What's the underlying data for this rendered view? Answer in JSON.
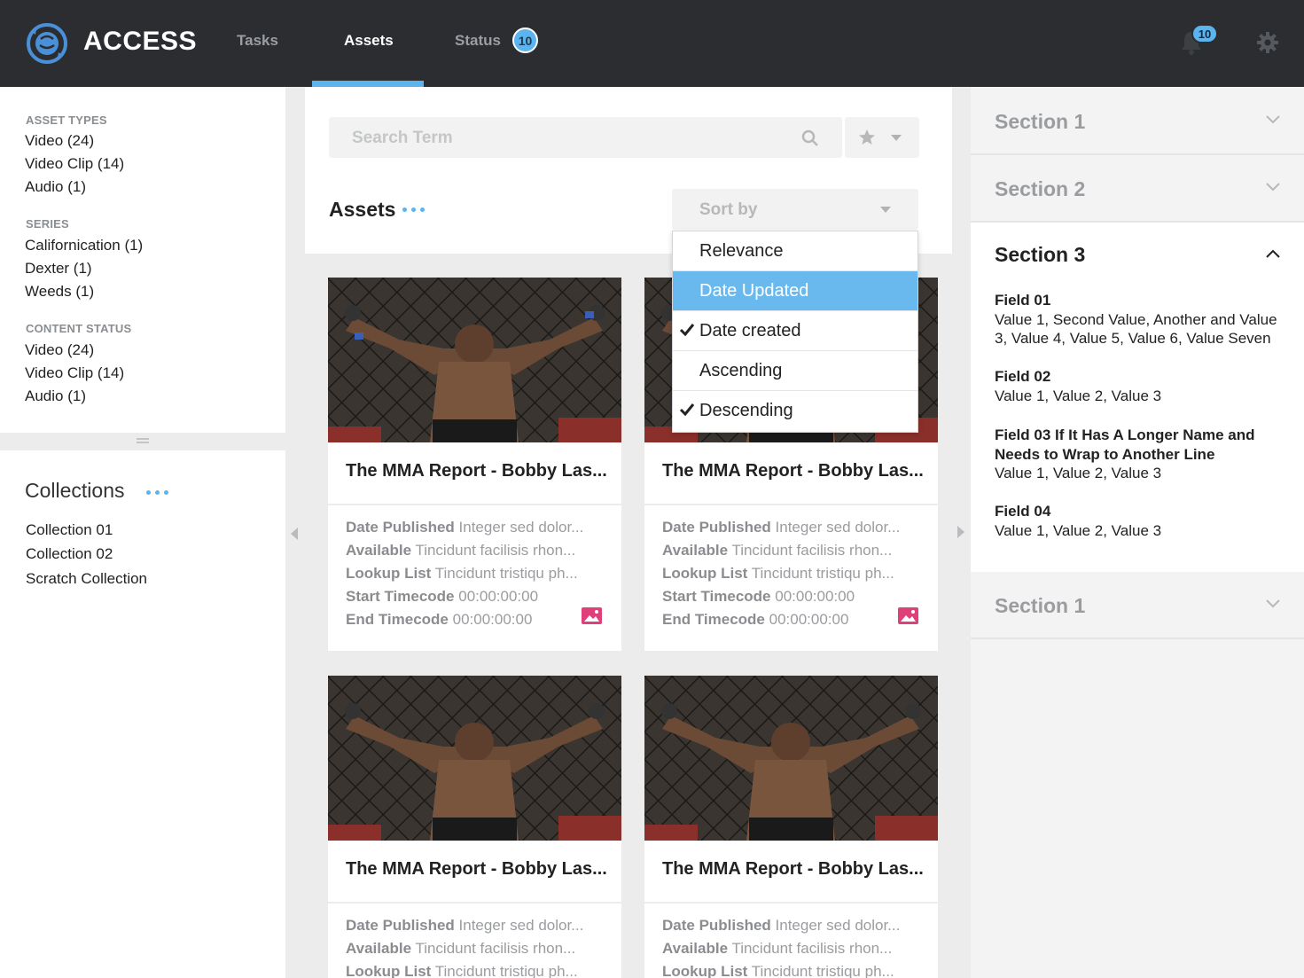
{
  "app": {
    "brand": "ACCESS",
    "nav": {
      "tasks": "Tasks",
      "assets": "Assets",
      "status": "Status",
      "status_badge": "10"
    },
    "notifications_count": "10",
    "accent_color": "#5bb4ee"
  },
  "sidebar": {
    "asset_types_heading": "ASSET TYPES",
    "asset_types": [
      "Video (24)",
      "Video Clip (14)",
      "Audio (1)"
    ],
    "series_heading": "SERIES",
    "series": [
      "Californication (1)",
      "Dexter (1)",
      "Weeds (1)"
    ],
    "content_status_heading": "CONTENT STATUS",
    "content_status": [
      "Video (24)",
      "Video Clip (14)",
      "Audio (1)"
    ],
    "collections_title": "Collections",
    "collections": [
      "Collection 01",
      "Collection 02",
      "Scratch Collection"
    ]
  },
  "main": {
    "search_placeholder": "Search Term",
    "assets_title": "Assets",
    "sort_label": "Sort by",
    "sort_options": [
      {
        "label": "Relevance",
        "selected": false,
        "checked": false
      },
      {
        "label": "Date Updated",
        "selected": true,
        "checked": false
      },
      {
        "label": "Date created",
        "selected": false,
        "checked": true
      },
      {
        "label": "Ascending",
        "selected": false,
        "checked": false
      },
      {
        "label": "Descending",
        "selected": false,
        "checked": true
      }
    ],
    "cards": [
      {
        "title": "The MMA Report - Bobby Las...",
        "date_label": "Date Published",
        "date_value": " Integer sed dolor...",
        "available_label": "Available",
        "available_value": " Tincidunt facilisis rhon...",
        "lookup_label": "Lookup List",
        "lookup_value": " Tincidunt tristiqu ph...",
        "start_label": "Start Timecode",
        "start_value": " 00:00:00:00",
        "end_label": "End Timecode",
        "end_value": " 00:00:00:00"
      },
      {
        "title": "The MMA Report - Bobby Las...",
        "date_label": "Date Published",
        "date_value": " Integer sed dolor...",
        "available_label": "Available",
        "available_value": " Tincidunt facilisis rhon...",
        "lookup_label": "Lookup List",
        "lookup_value": " Tincidunt tristiqu ph...",
        "start_label": "Start Timecode",
        "start_value": " 00:00:00:00",
        "end_label": "End Timecode",
        "end_value": " 00:00:00:00"
      },
      {
        "title": "The MMA Report - Bobby Las...",
        "date_label": "Date Published",
        "date_value": " Integer sed dolor...",
        "available_label": "Available",
        "available_value": " Tincidunt facilisis rhon...",
        "lookup_label": "Lookup List",
        "lookup_value": " Tincidunt tristiqu ph..."
      },
      {
        "title": "The MMA Report - Bobby Las...",
        "date_label": "Date Published",
        "date_value": " Integer sed dolor...",
        "available_label": "Available",
        "available_value": " Tincidunt facilisis rhon...",
        "lookup_label": "Lookup List",
        "lookup_value": " Tincidunt tristiqu ph..."
      }
    ]
  },
  "details": {
    "section1": "Section 1",
    "section2": "Section 2",
    "section3": "Section 3",
    "section4": "Section 1",
    "fields": [
      {
        "name": "Field 01",
        "value": "Value 1, Second Value, Another and Value 3, Value 4, Value 5, Value 6, Value Seven"
      },
      {
        "name": "Field 02",
        "value": "Value 1, Value 2, Value 3"
      },
      {
        "name": "Field 03 If It Has A Longer Name and Needs to Wrap to Another Line",
        "value": "Value 1, Value 2, Value 3"
      },
      {
        "name": "Field 04",
        "value": "Value 1, Value 2, Value 3"
      }
    ]
  }
}
